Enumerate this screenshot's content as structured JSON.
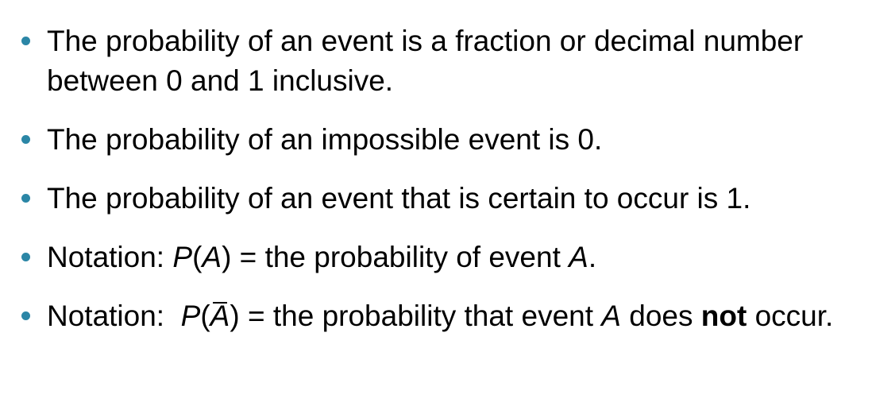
{
  "theme": {
    "bullet_color": "#2b86a6",
    "text_color": "#000000",
    "background": "#ffffff"
  },
  "bullets": [
    {
      "text": "The probability of an event is a fraction or decimal number between 0 and 1 inclusive."
    },
    {
      "text": "The probability of an impossible event is 0."
    },
    {
      "text": "The probability of an event that is certain to occur is 1."
    },
    {
      "prefix": "Notation: ",
      "func": "P",
      "open": "(",
      "var": "A",
      "close": ")",
      "middle": " = the probability of event ",
      "var2": "A",
      "suffix": "."
    },
    {
      "prefix": "Notation:  ",
      "func": "P",
      "open": "(",
      "var": "A",
      "close": ")",
      "middle": " = the probability that event ",
      "var2": "A",
      "middle2": " does ",
      "emphasis": "not",
      "suffix": " occur."
    }
  ]
}
